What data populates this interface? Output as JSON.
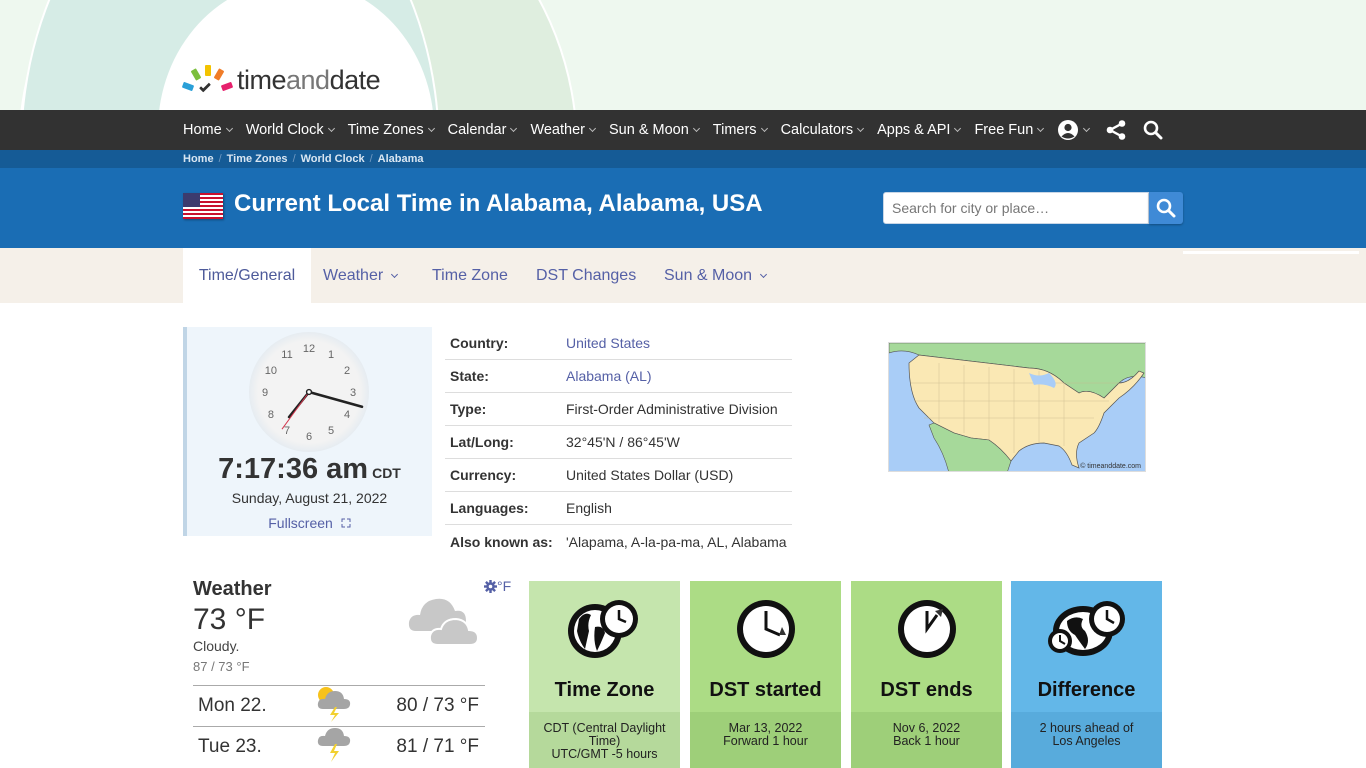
{
  "colors": {
    "nav_bg": "#323232",
    "breadcrumb_bg": "#155b96",
    "title_bg": "#1a6db4",
    "link": "#5560a6",
    "tile_time_zone": "#c5e5ad",
    "tile_dst_started": "#acdc85",
    "tile_dst_ends": "#acdc85",
    "tile_difference": "#63b7e8"
  },
  "brand": {
    "logo_pre": "time",
    "logo_mid": "and",
    "logo_post": "date"
  },
  "nav": {
    "items": [
      {
        "label": "Home"
      },
      {
        "label": "World Clock"
      },
      {
        "label": "Time Zones"
      },
      {
        "label": "Calendar"
      },
      {
        "label": "Weather"
      },
      {
        "label": "Sun & Moon"
      },
      {
        "label": "Timers"
      },
      {
        "label": "Calculators"
      },
      {
        "label": "Apps & API"
      },
      {
        "label": "Free Fun"
      }
    ],
    "icons": [
      "account-icon",
      "share-icon",
      "search-icon"
    ]
  },
  "breadcrumb": [
    "Home",
    "Time Zones",
    "World Clock",
    "Alabama"
  ],
  "title": {
    "flag": "us-flag-icon",
    "text": "Current Local Time in Alabama, Alabama, USA"
  },
  "search": {
    "placeholder": "Search for city or place…",
    "value": ""
  },
  "subtabs": [
    {
      "label": "Time/General",
      "active": true,
      "dropdown": false
    },
    {
      "label": "Weather",
      "active": false,
      "dropdown": true
    },
    {
      "label": "Time Zone",
      "active": false,
      "dropdown": false
    },
    {
      "label": "DST Changes",
      "active": false,
      "dropdown": false
    },
    {
      "label": "Sun & Moon",
      "active": false,
      "dropdown": true
    }
  ],
  "clock": {
    "numbers": [
      "12",
      "1",
      "2",
      "3",
      "4",
      "5",
      "6",
      "7",
      "8",
      "9",
      "10",
      "11"
    ],
    "hours": 7,
    "minutes": 17,
    "seconds": 36,
    "time": "7:17:36 am",
    "tz": "CDT",
    "date": "Sunday, August 21, 2022",
    "fullscreen_label": "Fullscreen"
  },
  "info": [
    {
      "label": "Country:",
      "value": "United States",
      "link": true
    },
    {
      "label": "State:",
      "value": "Alabama (AL)",
      "link": true
    },
    {
      "label": "Type:",
      "value": "First-Order Administrative Division",
      "link": false
    },
    {
      "label": "Lat/Long:",
      "value": "32°45'N / 86°45'W",
      "link": false
    },
    {
      "label": "Currency:",
      "value": "United States Dollar (USD)",
      "link": false
    },
    {
      "label": "Languages:",
      "value": "English",
      "link": false
    },
    {
      "label": "Also known as:",
      "value": "'Alapama, A-la-pa-ma, AL, Alabama",
      "link": false
    }
  ],
  "map": {
    "copyright": "© timeanddate.com"
  },
  "weather": {
    "title": "Weather",
    "temp": "73 °F",
    "desc": "Cloudy.",
    "range": "87 / 73 °F",
    "unit_label": "°F",
    "icon": "cloudy-icon",
    "forecast": [
      {
        "day": "Mon 22.",
        "icon": "sun-thunderstorm-icon",
        "range": "80 / 73 °F"
      },
      {
        "day": "Tue 23.",
        "icon": "thunderstorm-icon",
        "range": "81 / 71 °F"
      }
    ]
  },
  "tiles": [
    {
      "title": "Time Zone",
      "line1": "CDT (Central Daylight Time)",
      "line2": "UTC/GMT -5 hours",
      "icon": "globe-clock-icon"
    },
    {
      "title": "DST started",
      "line1": "Mar 13, 2022",
      "line2": "Forward 1 hour",
      "icon": "clock-forward-icon"
    },
    {
      "title": "DST ends",
      "line1": "Nov 6, 2022",
      "line2": "Back 1 hour",
      "icon": "clock-back-icon"
    },
    {
      "title": "Difference",
      "line1": "2 hours ahead of",
      "line2": "Los Angeles",
      "icon": "globe-clocks-icon"
    }
  ]
}
